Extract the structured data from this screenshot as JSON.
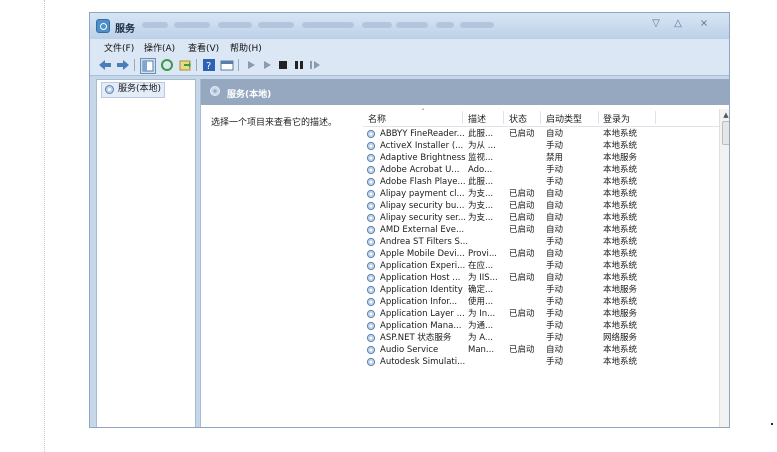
{
  "window": {
    "title": "服务",
    "menu": [
      "文件(F)",
      "操作(A)",
      "查看(V)",
      "帮助(H)"
    ]
  },
  "left_pane": {
    "tree_item": "服务(本地)"
  },
  "right_pane": {
    "header_title": "服务(本地)",
    "description": "选择一个项目来查看它的描述。",
    "columns": [
      "名称",
      "描述",
      "状态",
      "启动类型",
      "登录为"
    ],
    "rows": [
      {
        "name": "ABBYY FineReader...",
        "desc": "此服...",
        "status": "已启动",
        "startup": "自动",
        "logon": "本地系统"
      },
      {
        "name": "ActiveX Installer (...",
        "desc": "为从 ...",
        "status": "",
        "startup": "手动",
        "logon": "本地系统"
      },
      {
        "name": "Adaptive Brightness",
        "desc": "监视...",
        "status": "",
        "startup": "禁用",
        "logon": "本地服务"
      },
      {
        "name": "Adobe Acrobat U...",
        "desc": "Ado...",
        "status": "",
        "startup": "手动",
        "logon": "本地系统"
      },
      {
        "name": "Adobe Flash Playe...",
        "desc": "此服...",
        "status": "",
        "startup": "手动",
        "logon": "本地系统"
      },
      {
        "name": "Alipay payment cl...",
        "desc": "为支...",
        "status": "已启动",
        "startup": "自动",
        "logon": "本地系统"
      },
      {
        "name": "Alipay security bu...",
        "desc": "为支...",
        "status": "已启动",
        "startup": "自动",
        "logon": "本地系统"
      },
      {
        "name": "Alipay security ser...",
        "desc": "为支...",
        "status": "已启动",
        "startup": "自动",
        "logon": "本地系统"
      },
      {
        "name": "AMD External Eve...",
        "desc": "",
        "status": "已启动",
        "startup": "自动",
        "logon": "本地系统"
      },
      {
        "name": "Andrea ST Filters S...",
        "desc": "",
        "status": "",
        "startup": "手动",
        "logon": "本地系统"
      },
      {
        "name": "Apple Mobile Devi...",
        "desc": "Provi...",
        "status": "已启动",
        "startup": "自动",
        "logon": "本地系统"
      },
      {
        "name": "Application Experi...",
        "desc": "在应...",
        "status": "",
        "startup": "手动",
        "logon": "本地系统"
      },
      {
        "name": "Application Host ...",
        "desc": "为 IIS...",
        "status": "已启动",
        "startup": "自动",
        "logon": "本地系统"
      },
      {
        "name": "Application Identity",
        "desc": "确定...",
        "status": "",
        "startup": "手动",
        "logon": "本地服务"
      },
      {
        "name": "Application Infor...",
        "desc": "使用...",
        "status": "",
        "startup": "手动",
        "logon": "本地系统"
      },
      {
        "name": "Application Layer ...",
        "desc": "为 In...",
        "status": "已启动",
        "startup": "手动",
        "logon": "本地服务"
      },
      {
        "name": "Application Mana...",
        "desc": "为通...",
        "status": "",
        "startup": "手动",
        "logon": "本地系统"
      },
      {
        "name": "ASP.NET 状态服务",
        "desc": "为 A...",
        "status": "",
        "startup": "手动",
        "logon": "网络服务"
      },
      {
        "name": "Audio Service",
        "desc": "Man...",
        "status": "已启动",
        "startup": "自动",
        "logon": "本地系统"
      },
      {
        "name": "Autodesk Simulati...",
        "desc": "",
        "status": "",
        "startup": "手动",
        "logon": "本地系统"
      }
    ]
  },
  "icons": {
    "app": "gear-window-icon",
    "service": "service-gear-icon",
    "toolbar": [
      "back-arrow-icon",
      "forward-arrow-icon",
      "console-tree-icon",
      "refresh-icon",
      "export-icon",
      "help-icon",
      "properties-icon",
      "start-icon",
      "start-alt-icon",
      "stop-icon",
      "pause-icon",
      "restart-icon"
    ]
  },
  "colors": {
    "titlebar": "#c7d7ea",
    "pane_header": "#95a8c0",
    "accent": "#4f8fc9"
  }
}
